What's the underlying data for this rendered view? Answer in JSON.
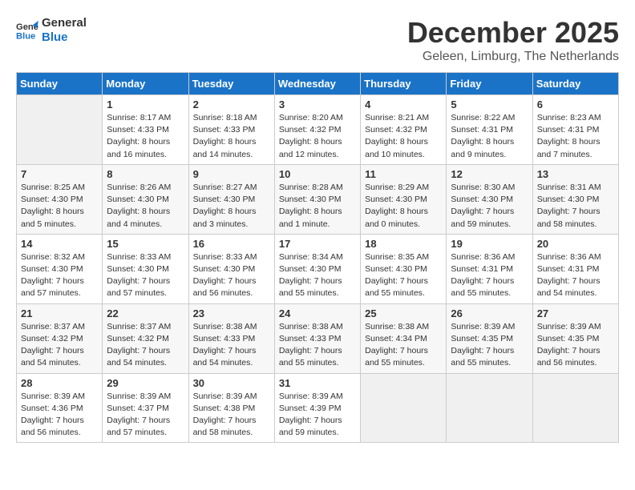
{
  "logo": {
    "line1": "General",
    "line2": "Blue"
  },
  "title": "December 2025",
  "location": "Geleen, Limburg, The Netherlands",
  "days_of_week": [
    "Sunday",
    "Monday",
    "Tuesday",
    "Wednesday",
    "Thursday",
    "Friday",
    "Saturday"
  ],
  "weeks": [
    [
      {
        "day": "",
        "info": ""
      },
      {
        "day": "1",
        "info": "Sunrise: 8:17 AM\nSunset: 4:33 PM\nDaylight: 8 hours\nand 16 minutes."
      },
      {
        "day": "2",
        "info": "Sunrise: 8:18 AM\nSunset: 4:33 PM\nDaylight: 8 hours\nand 14 minutes."
      },
      {
        "day": "3",
        "info": "Sunrise: 8:20 AM\nSunset: 4:32 PM\nDaylight: 8 hours\nand 12 minutes."
      },
      {
        "day": "4",
        "info": "Sunrise: 8:21 AM\nSunset: 4:32 PM\nDaylight: 8 hours\nand 10 minutes."
      },
      {
        "day": "5",
        "info": "Sunrise: 8:22 AM\nSunset: 4:31 PM\nDaylight: 8 hours\nand 9 minutes."
      },
      {
        "day": "6",
        "info": "Sunrise: 8:23 AM\nSunset: 4:31 PM\nDaylight: 8 hours\nand 7 minutes."
      }
    ],
    [
      {
        "day": "7",
        "info": "Sunrise: 8:25 AM\nSunset: 4:30 PM\nDaylight: 8 hours\nand 5 minutes."
      },
      {
        "day": "8",
        "info": "Sunrise: 8:26 AM\nSunset: 4:30 PM\nDaylight: 8 hours\nand 4 minutes."
      },
      {
        "day": "9",
        "info": "Sunrise: 8:27 AM\nSunset: 4:30 PM\nDaylight: 8 hours\nand 3 minutes."
      },
      {
        "day": "10",
        "info": "Sunrise: 8:28 AM\nSunset: 4:30 PM\nDaylight: 8 hours\nand 1 minute."
      },
      {
        "day": "11",
        "info": "Sunrise: 8:29 AM\nSunset: 4:30 PM\nDaylight: 8 hours\nand 0 minutes."
      },
      {
        "day": "12",
        "info": "Sunrise: 8:30 AM\nSunset: 4:30 PM\nDaylight: 7 hours\nand 59 minutes."
      },
      {
        "day": "13",
        "info": "Sunrise: 8:31 AM\nSunset: 4:30 PM\nDaylight: 7 hours\nand 58 minutes."
      }
    ],
    [
      {
        "day": "14",
        "info": "Sunrise: 8:32 AM\nSunset: 4:30 PM\nDaylight: 7 hours\nand 57 minutes."
      },
      {
        "day": "15",
        "info": "Sunrise: 8:33 AM\nSunset: 4:30 PM\nDaylight: 7 hours\nand 57 minutes."
      },
      {
        "day": "16",
        "info": "Sunrise: 8:33 AM\nSunset: 4:30 PM\nDaylight: 7 hours\nand 56 minutes."
      },
      {
        "day": "17",
        "info": "Sunrise: 8:34 AM\nSunset: 4:30 PM\nDaylight: 7 hours\nand 55 minutes."
      },
      {
        "day": "18",
        "info": "Sunrise: 8:35 AM\nSunset: 4:30 PM\nDaylight: 7 hours\nand 55 minutes."
      },
      {
        "day": "19",
        "info": "Sunrise: 8:36 AM\nSunset: 4:31 PM\nDaylight: 7 hours\nand 55 minutes."
      },
      {
        "day": "20",
        "info": "Sunrise: 8:36 AM\nSunset: 4:31 PM\nDaylight: 7 hours\nand 54 minutes."
      }
    ],
    [
      {
        "day": "21",
        "info": "Sunrise: 8:37 AM\nSunset: 4:32 PM\nDaylight: 7 hours\nand 54 minutes."
      },
      {
        "day": "22",
        "info": "Sunrise: 8:37 AM\nSunset: 4:32 PM\nDaylight: 7 hours\nand 54 minutes."
      },
      {
        "day": "23",
        "info": "Sunrise: 8:38 AM\nSunset: 4:33 PM\nDaylight: 7 hours\nand 54 minutes."
      },
      {
        "day": "24",
        "info": "Sunrise: 8:38 AM\nSunset: 4:33 PM\nDaylight: 7 hours\nand 55 minutes."
      },
      {
        "day": "25",
        "info": "Sunrise: 8:38 AM\nSunset: 4:34 PM\nDaylight: 7 hours\nand 55 minutes."
      },
      {
        "day": "26",
        "info": "Sunrise: 8:39 AM\nSunset: 4:35 PM\nDaylight: 7 hours\nand 55 minutes."
      },
      {
        "day": "27",
        "info": "Sunrise: 8:39 AM\nSunset: 4:35 PM\nDaylight: 7 hours\nand 56 minutes."
      }
    ],
    [
      {
        "day": "28",
        "info": "Sunrise: 8:39 AM\nSunset: 4:36 PM\nDaylight: 7 hours\nand 56 minutes."
      },
      {
        "day": "29",
        "info": "Sunrise: 8:39 AM\nSunset: 4:37 PM\nDaylight: 7 hours\nand 57 minutes."
      },
      {
        "day": "30",
        "info": "Sunrise: 8:39 AM\nSunset: 4:38 PM\nDaylight: 7 hours\nand 58 minutes."
      },
      {
        "day": "31",
        "info": "Sunrise: 8:39 AM\nSunset: 4:39 PM\nDaylight: 7 hours\nand 59 minutes."
      },
      {
        "day": "",
        "info": ""
      },
      {
        "day": "",
        "info": ""
      },
      {
        "day": "",
        "info": ""
      }
    ]
  ]
}
